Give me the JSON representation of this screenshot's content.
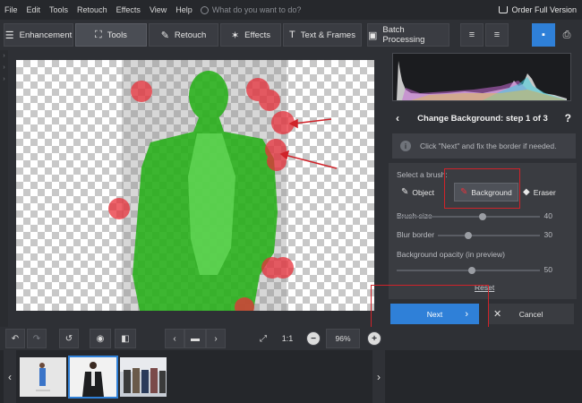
{
  "menu": {
    "items": [
      "File",
      "Edit",
      "Tools",
      "Retouch",
      "Effects",
      "View",
      "Help"
    ],
    "search_placeholder": "What do you want to do?",
    "order_label": "Order Full Version"
  },
  "tabs": {
    "enhancement": "Enhancement",
    "tools": "Tools",
    "retouch": "Retouch",
    "effects": "Effects",
    "text_frames": "Text & Frames",
    "batch": "Batch Processing"
  },
  "panel": {
    "title": "Change Background: step 1 of 3",
    "help": "?",
    "hint": "Click \"Next\" and fix the border if needed.",
    "select_brush": "Select a brush:",
    "brush_object": "Object",
    "brush_background": "Background",
    "brush_eraser": "Eraser",
    "brush_size_label": "Brush size",
    "brush_size_value": "40",
    "blur_border_label": "Blur border",
    "blur_border_value": "30",
    "opacity_label": "Background opacity (in preview)",
    "opacity_value": "50",
    "reset": "Reset",
    "next": "Next",
    "cancel": "Cancel"
  },
  "toolbar": {
    "fit_label": "1:1",
    "zoom": "96%"
  },
  "colors": {
    "accent": "#2f80d8",
    "annotation": "#d0232a",
    "object_mask": "#22b014",
    "background_mask": "#e8303a"
  }
}
